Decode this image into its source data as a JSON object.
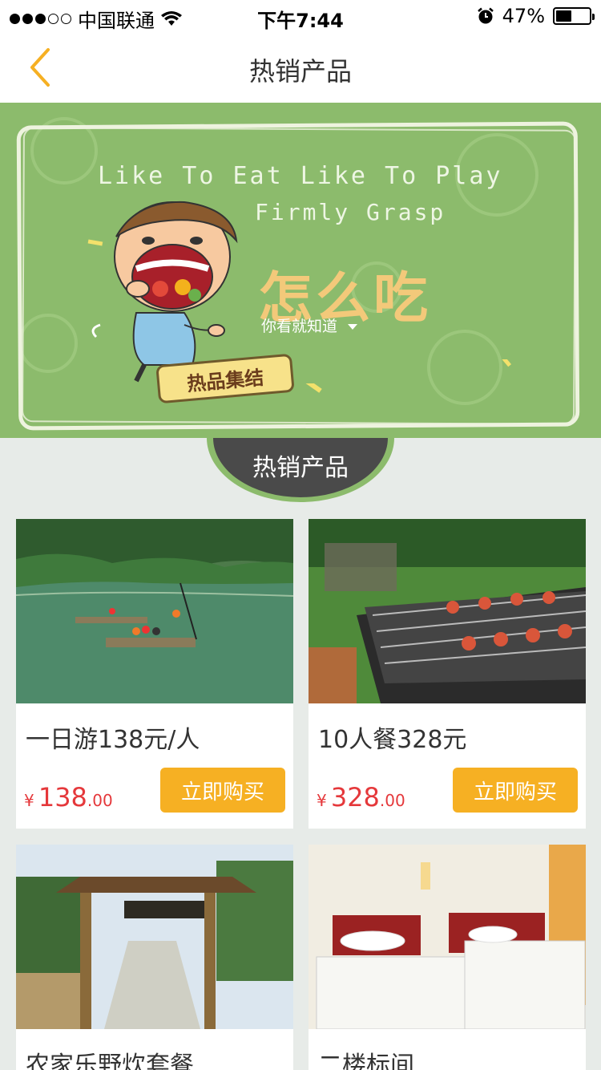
{
  "status_bar": {
    "carrier": "中国联通",
    "time": "下午7:44",
    "battery": "47%",
    "signal_bars": 3,
    "battery_level": 0.47
  },
  "nav": {
    "title": "热销产品"
  },
  "banner": {
    "line1": "Like To Eat Like To Play",
    "line2": "Firmly Grasp",
    "headline": "怎么吃",
    "subline": "你看就知道",
    "tag": "热品集结"
  },
  "section": {
    "title": "热销产品"
  },
  "products": [
    {
      "name": "一日游138元/人",
      "currency": "¥",
      "price_int": "138",
      "price_dec": ".00",
      "buy_label": "立即购买"
    },
    {
      "name": "10人餐328元",
      "currency": "¥",
      "price_int": "328",
      "price_dec": ".00",
      "buy_label": "立即购买"
    },
    {
      "name": "农家乐野炊套餐"
    },
    {
      "name": "二楼标间"
    }
  ],
  "colors": {
    "accent": "#f6b023",
    "price": "#e5383b",
    "banner_green": "#8cbb6c",
    "badge_dark": "#4a4a4a"
  }
}
